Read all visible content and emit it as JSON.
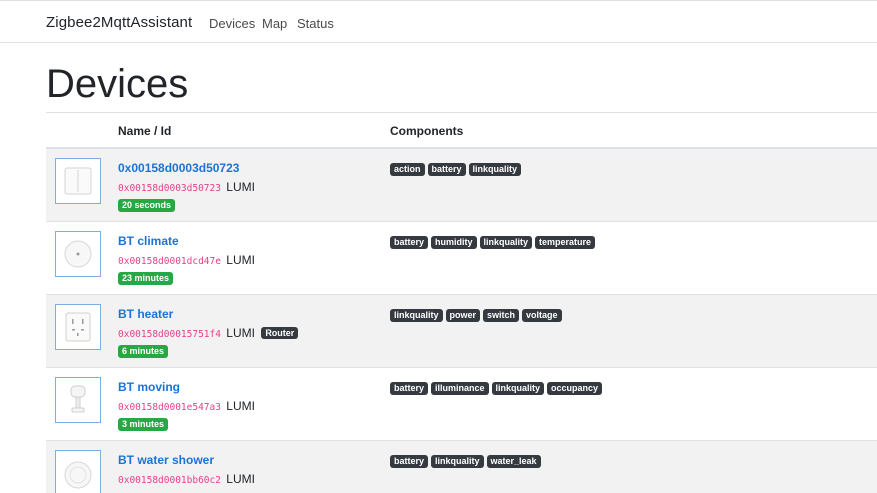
{
  "navbar": {
    "brand": "Zigbee2MqttAssistant",
    "links": [
      "Devices",
      "Map",
      "Status"
    ]
  },
  "page": {
    "title": "Devices"
  },
  "table": {
    "headers": [
      "Name / Id",
      "Components"
    ],
    "rows": [
      {
        "name": "0x00158d0003d50723",
        "id": "0x00158d0003d50723",
        "vendor": "LUMI",
        "router": "",
        "last_seen": "20 seconds",
        "components": [
          "action",
          "battery",
          "linkquality"
        ],
        "icon": "wall-switch-icon"
      },
      {
        "name": "BT climate",
        "id": "0x00158d0001dcd47e",
        "vendor": "LUMI",
        "router": "",
        "last_seen": "23 minutes",
        "components": [
          "battery",
          "humidity",
          "linkquality",
          "temperature"
        ],
        "icon": "climate-sensor-icon"
      },
      {
        "name": "BT heater",
        "id": "0x00158d00015751f4",
        "vendor": "LUMI",
        "router": "Router",
        "last_seen": "6 minutes",
        "components": [
          "linkquality",
          "power",
          "switch",
          "voltage"
        ],
        "icon": "wall-outlet-icon"
      },
      {
        "name": "BT moving",
        "id": "0x00158d0001e547a3",
        "vendor": "LUMI",
        "router": "",
        "last_seen": "3 minutes",
        "components": [
          "battery",
          "illuminance",
          "linkquality",
          "occupancy"
        ],
        "icon": "motion-sensor-icon"
      },
      {
        "name": "BT water shower",
        "id": "0x00158d0001bb60c2",
        "vendor": "LUMI",
        "router": "",
        "last_seen": "",
        "components": [
          "battery",
          "linkquality",
          "water_leak"
        ],
        "icon": "water-leak-sensor-icon"
      }
    ]
  },
  "colors": {
    "link": "#1a73d6",
    "id_code": "#e83e8c",
    "badge_dark": "#343a40",
    "badge_success": "#28a745",
    "row_stripe": "#f2f2f2"
  }
}
